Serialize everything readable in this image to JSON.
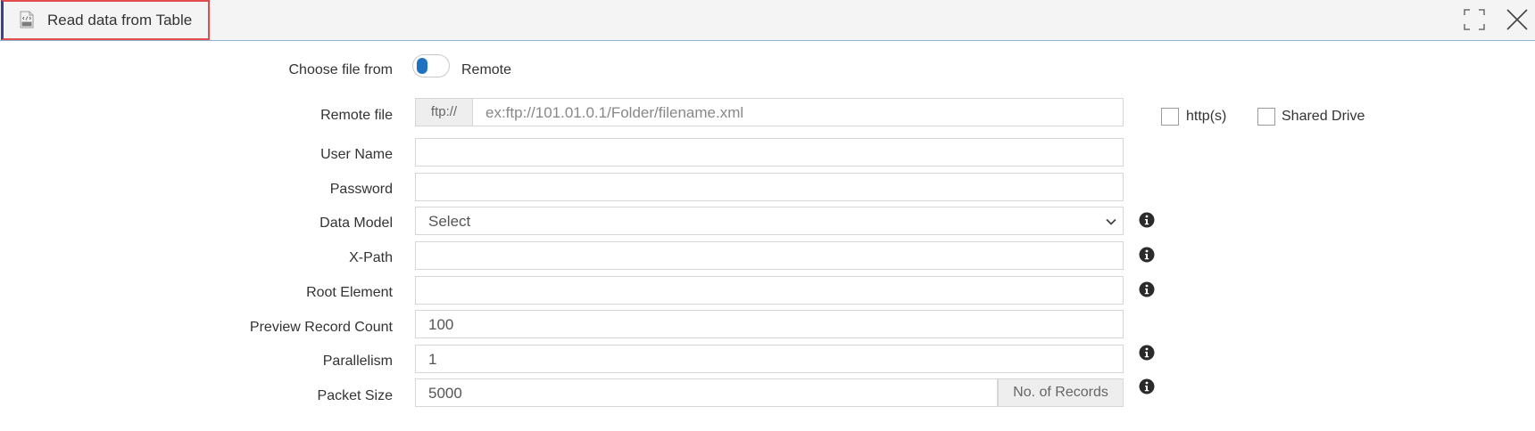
{
  "window": {
    "title": "Read data from Table"
  },
  "form": {
    "choose_file_from": {
      "label": "Choose file from",
      "toggle_text": "Remote"
    },
    "remote_file": {
      "label": "Remote file",
      "prefix": "ftp://",
      "placeholder": "ex:ftp://101.01.0.1/Folder/filename.xml"
    },
    "options": {
      "https_label": "http(s)",
      "shared_drive_label": "Shared Drive"
    },
    "user_name": {
      "label": "User Name",
      "value": ""
    },
    "password": {
      "label": "Password",
      "value": ""
    },
    "data_model": {
      "label": "Data Model",
      "selected": "Select"
    },
    "x_path": {
      "label": "X-Path",
      "value": ""
    },
    "root_element": {
      "label": "Root Element",
      "value": ""
    },
    "preview_record_count": {
      "label": "Preview Record Count",
      "value": "100"
    },
    "parallelism": {
      "label": "Parallelism",
      "value": "1"
    },
    "packet_size": {
      "label": "Packet Size",
      "value": "5000",
      "suffix": "No. of Records"
    }
  },
  "icons": {
    "file": "xml-file-icon",
    "maximize": "maximize-icon",
    "close": "close-icon",
    "info": "info-icon",
    "dropdown": "chevron-down-icon"
  },
  "colors": {
    "accent": "#1e72c0",
    "title_highlight": "#e24c4c",
    "title_bar_bg": "#f4f4f4",
    "title_bar_border": "#8fb4cf",
    "addon_bg": "#eeeeee"
  }
}
